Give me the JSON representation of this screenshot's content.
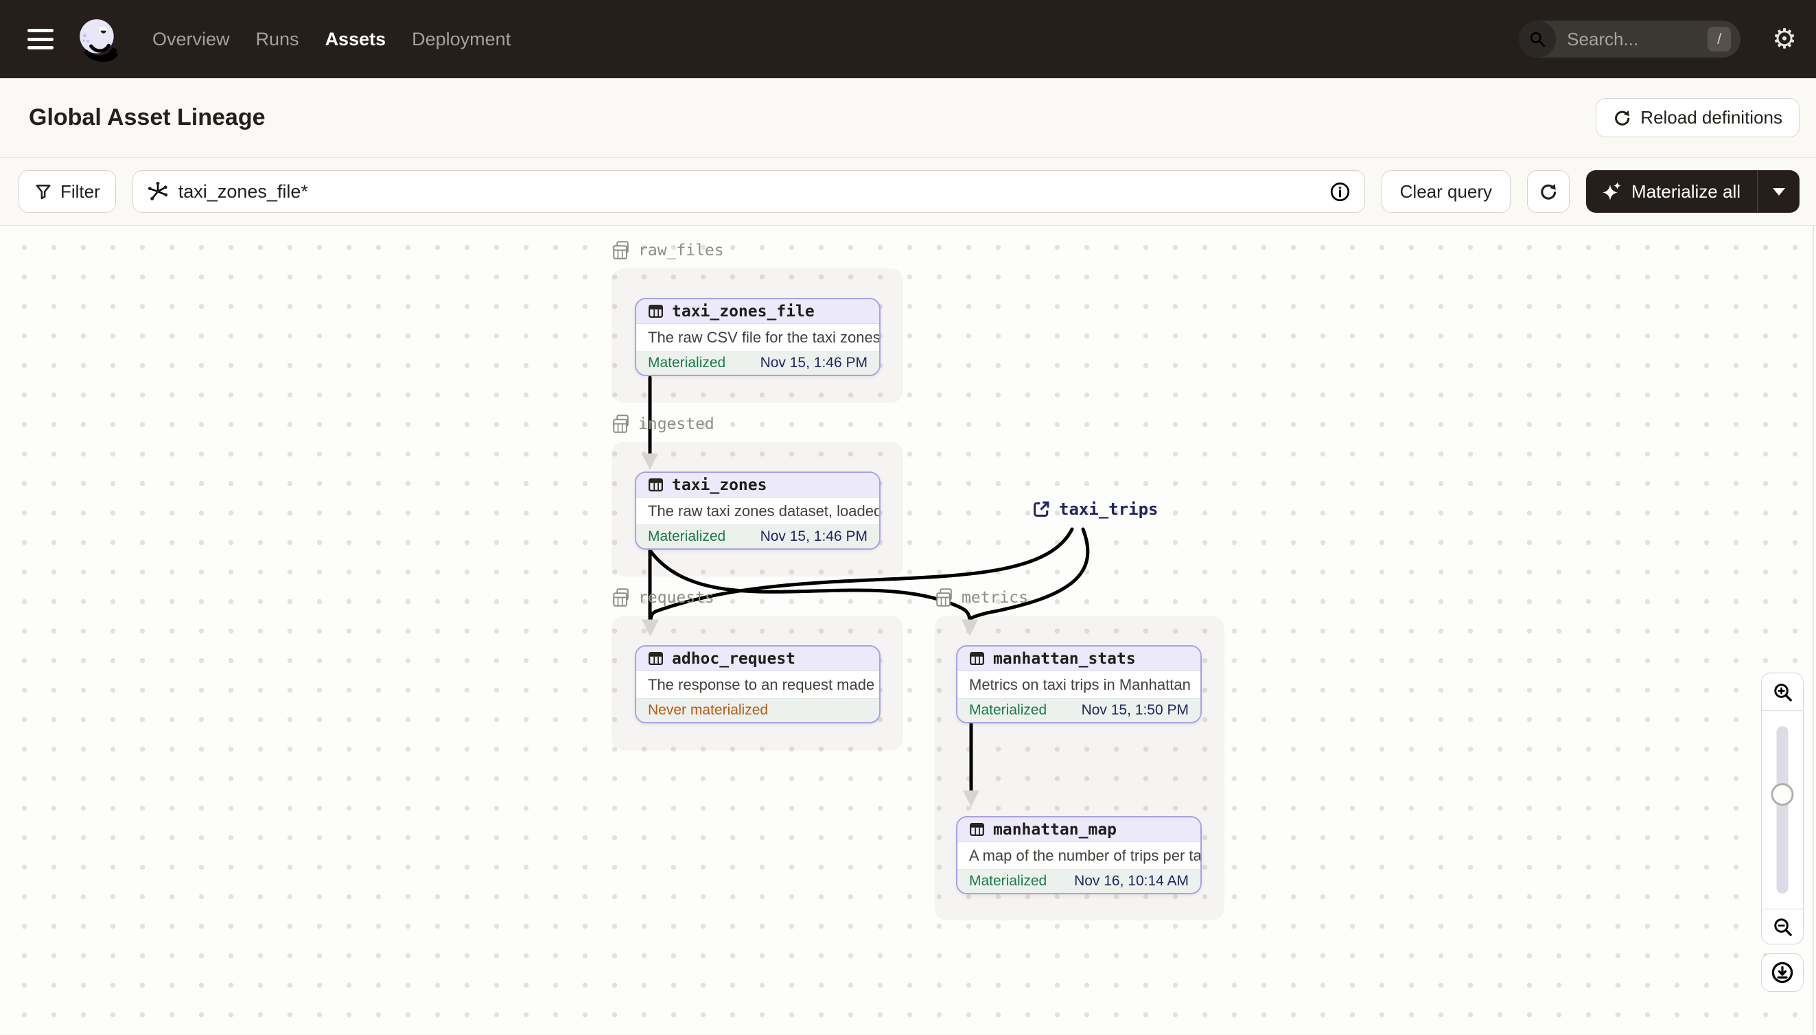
{
  "nav": {
    "items": [
      "Overview",
      "Runs",
      "Assets",
      "Deployment"
    ],
    "active_item": "Assets",
    "search": {
      "placeholder": "Search...",
      "shortcut": "/"
    }
  },
  "header": {
    "title": "Global Asset Lineage",
    "reload_label": "Reload definitions"
  },
  "toolbar": {
    "filter_label": "Filter",
    "query_value": "taxi_zones_file*",
    "clear_label": "Clear query",
    "materialize_label": "Materialize all"
  },
  "graph": {
    "groups": [
      {
        "label": "raw_files"
      },
      {
        "label": "ingested"
      },
      {
        "label": "requests"
      },
      {
        "label": "metrics"
      }
    ],
    "nodes": [
      {
        "name": "taxi_zones_file",
        "group": "raw_files",
        "description": "The raw CSV file for the taxi zones dat...",
        "status": "Materialized",
        "timestamp": "Nov 15, 1:46 PM"
      },
      {
        "name": "taxi_zones",
        "group": "ingested",
        "description": "The raw taxi zones dataset, loaded int...",
        "status": "Materialized",
        "timestamp": "Nov 15, 1:46 PM"
      },
      {
        "name": "adhoc_request",
        "group": "requests",
        "description": "The response to an request made in th...",
        "status": "Never materialized",
        "timestamp": ""
      },
      {
        "name": "manhattan_stats",
        "group": "metrics",
        "description": "Metrics on taxi trips in Manhattan",
        "status": "Materialized",
        "timestamp": "Nov 15, 1:50 PM"
      },
      {
        "name": "manhattan_map",
        "group": "metrics",
        "description": "A map of the number of trips per taxi z...",
        "status": "Materialized",
        "timestamp": "Nov 16, 10:14 AM"
      }
    ],
    "external_assets": [
      {
        "name": "taxi_trips"
      }
    ],
    "edges": [
      {
        "from": "taxi_zones_file",
        "to": "taxi_zones"
      },
      {
        "from": "taxi_zones",
        "to": "adhoc_request"
      },
      {
        "from": "taxi_zones",
        "to": "manhattan_stats"
      },
      {
        "from": "taxi_trips",
        "to": "adhoc_request"
      },
      {
        "from": "taxi_trips",
        "to": "manhattan_stats"
      },
      {
        "from": "manhattan_stats",
        "to": "manhattan_map"
      }
    ]
  },
  "colors": {
    "topbar": "#241F1B",
    "accent_purple_border": "#A6A1E6",
    "node_header_lavender": "#ECEAFA",
    "materialized_green": "#1A7A4A",
    "never_materialized_orange": "#B45A17",
    "timestamp_navy": "#1F2664",
    "external_link_navy": "#20265E",
    "edge_gray": "#DFDCD8"
  }
}
